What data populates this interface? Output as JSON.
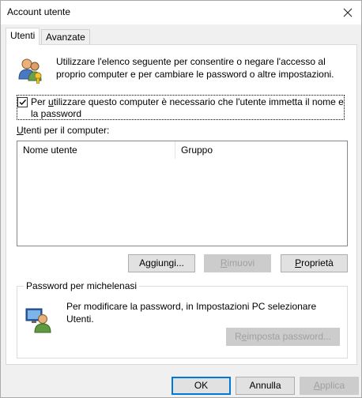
{
  "window": {
    "title": "Account utente",
    "close_glyph": "✕"
  },
  "tabs": [
    {
      "label": "Utenti",
      "active": true
    },
    {
      "label": "Avanzate",
      "active": false
    }
  ],
  "info": {
    "icon": "users-key-icon",
    "text": "Utilizzare l'elenco seguente per consentire o negare l'accesso al proprio computer e per cambiare le password o altre impostazioni."
  },
  "require_login": {
    "checked": true,
    "label_pre": "Per ",
    "label_key": "u",
    "label_post": "tilizzare questo computer è necessario che l'utente immetta il nome e la password"
  },
  "users_list": {
    "label_key": "U",
    "label_rest": "tenti per il computer:",
    "columns": [
      "Nome utente",
      "Gruppo"
    ],
    "rows": []
  },
  "list_buttons": {
    "add": {
      "pre": "A",
      "key": "g",
      "post": "giungi..."
    },
    "remove": {
      "pre": "",
      "key": "R",
      "post": "imuovi"
    },
    "properties": {
      "pre": "",
      "key": "P",
      "post": "roprietà"
    }
  },
  "password_group": {
    "title": "Password per michelenasi",
    "icon": "user-monitor-icon",
    "text": "Per modificare la password, in Impostazioni PC selezionare Utenti.",
    "reset_button": {
      "pre": "R",
      "key": "e",
      "post": "imposta password..."
    }
  },
  "dialog_buttons": {
    "ok": "OK",
    "cancel": "Annulla",
    "apply": {
      "pre": "",
      "key": "A",
      "post": "pplica"
    }
  }
}
